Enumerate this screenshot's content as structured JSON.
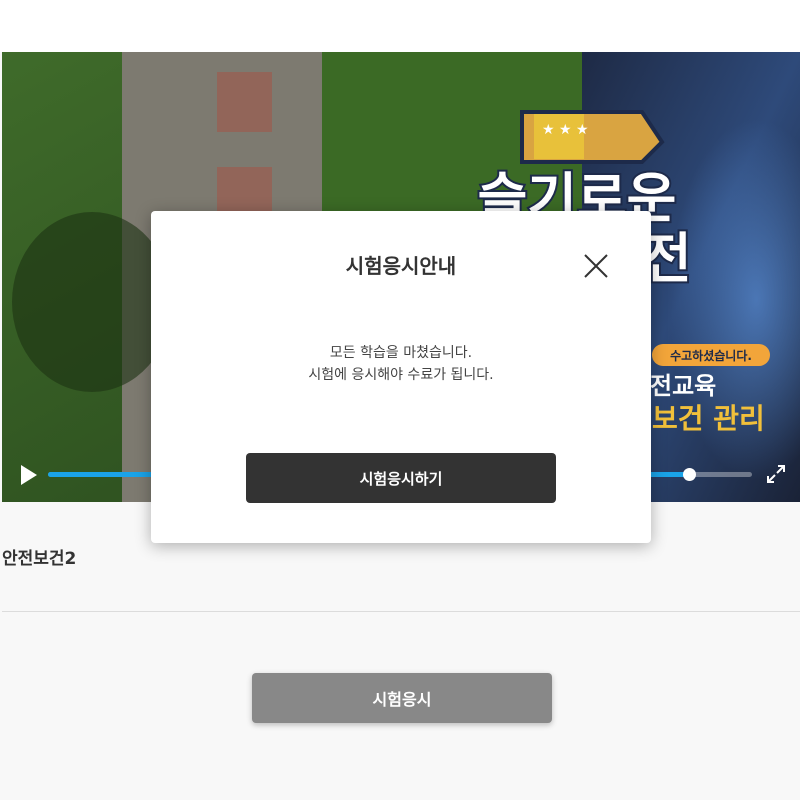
{
  "video": {
    "overlay": {
      "title_line1": "슬기로운",
      "title_line2": "안전",
      "badge": "수고하셨습니다.",
      "subtitle1": "전교육",
      "subtitle2": "보건 관리"
    },
    "progress_fraction": 0.91,
    "colors": {
      "progress": "#1aa3e8"
    }
  },
  "course": {
    "title": "안전보건2"
  },
  "page": {
    "exam_button": "시험응시"
  },
  "modal": {
    "title": "시험응시안내",
    "message_line1": "모든 학습을 마쳤습니다.",
    "message_line2": "시험에 응시해야 수료가 됩니다.",
    "button": "시험응시하기",
    "close_icon": "close-icon"
  }
}
